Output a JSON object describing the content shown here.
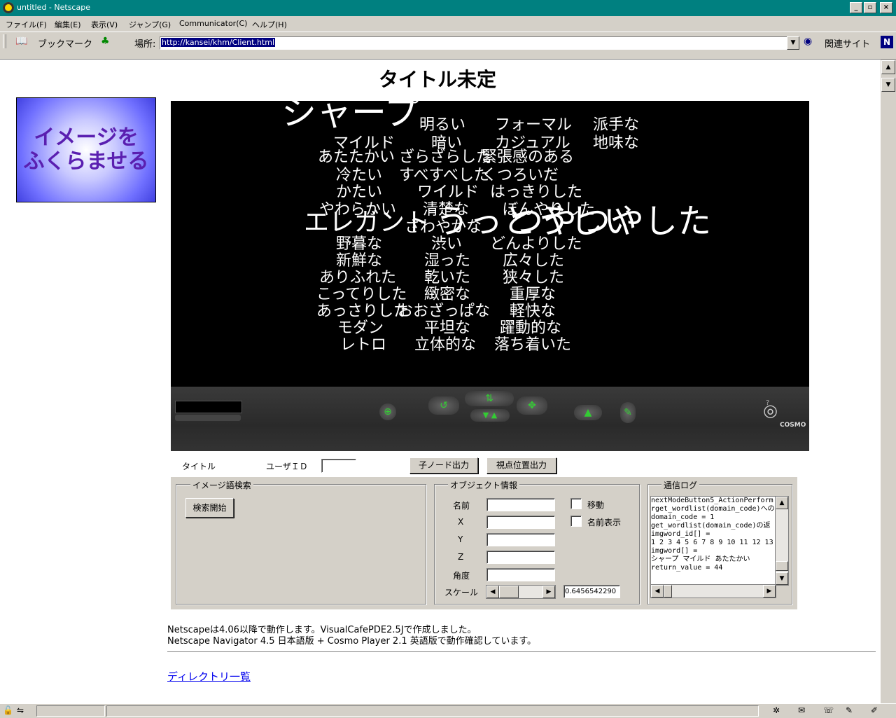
{
  "window": {
    "title": "untitled - Netscape"
  },
  "menu": [
    "ファイル(F)",
    "編集(E)",
    "表示(V)",
    "ジャンプ(G)",
    "Communicator(C)",
    "ヘルプ(H)"
  ],
  "toolbar": {
    "bookmarks_label": "ブックマーク",
    "location_label": "場所:",
    "url": "http://kansei/khm/Client.html",
    "related_label": "関連サイト"
  },
  "page": {
    "title": "タイトル未定",
    "inflate_button": "イメージを\nふくらませる",
    "footer_line1": "Netscapeは4.06以降で動作します。VisualCafePDE2.5Jで作成しました。",
    "footer_line2": "Netscape Navigator 4.5 日本語版 + Cosmo Player 2.1 英語版で動作確認しています。",
    "directory_link": "ディレクトリ一覧"
  },
  "words": [
    "シャープ",
    "明るい",
    "フォーマル",
    "派手な",
    "マイルド",
    "暗い",
    "カジュアル",
    "地味な",
    "あたたかい",
    "ざらざらした",
    "緊張感のある",
    "冷たい",
    "すべすべした",
    "くつろいだ",
    "かたい",
    "ワイルド",
    "はっきりした",
    "やわらかい",
    "清楚な",
    "ぼんやりした",
    "エレガント",
    "さわやかな",
    "うっとうしい",
    "つやつやした",
    "野暮な",
    "渋い",
    "どんよりした",
    "新鮮な",
    "湿った",
    "広々した",
    "ありふれた",
    "乾いた",
    "狭々した",
    "こってりした",
    "緻密な",
    "重厚な",
    "あっさりした",
    "おおざっぱな",
    "軽快な",
    "モダン",
    "平坦な",
    "躍動的な",
    "レトロ",
    "立体的な",
    "落ち着いた"
  ],
  "cosmo": {
    "brand": "COSMO"
  },
  "applet": {
    "title_label": "タイトル",
    "userid_label": "ユーザＩＤ",
    "userid_value": "",
    "child_node_button": "子ノード出力",
    "viewpoint_button": "視点位置出力",
    "search_group": "イメージ語検索",
    "search_button": "検索開始",
    "object_group": "オブジェクト情報",
    "name_label": "名前",
    "x_label": "X",
    "y_label": "Y",
    "z_label": "Z",
    "angle_label": "角度",
    "scale_label": "スケール",
    "scale_value": "0.6456542290",
    "move_label": "移動",
    "show_name_label": "名前表示",
    "log_group": "通信ログ",
    "log_text": "nextModeButton5_ActionPerform\nrget_wordlist(domain_code)への\ndomain_code = 1\nget_wordlist(domain_code)の返\nimgword_id[] =\n1 2 3 4 5 6 7 8 9 10 11 12 13\nimgword[] =\nシャープ マイルド あたたかい\nreturn_value = 44"
  }
}
